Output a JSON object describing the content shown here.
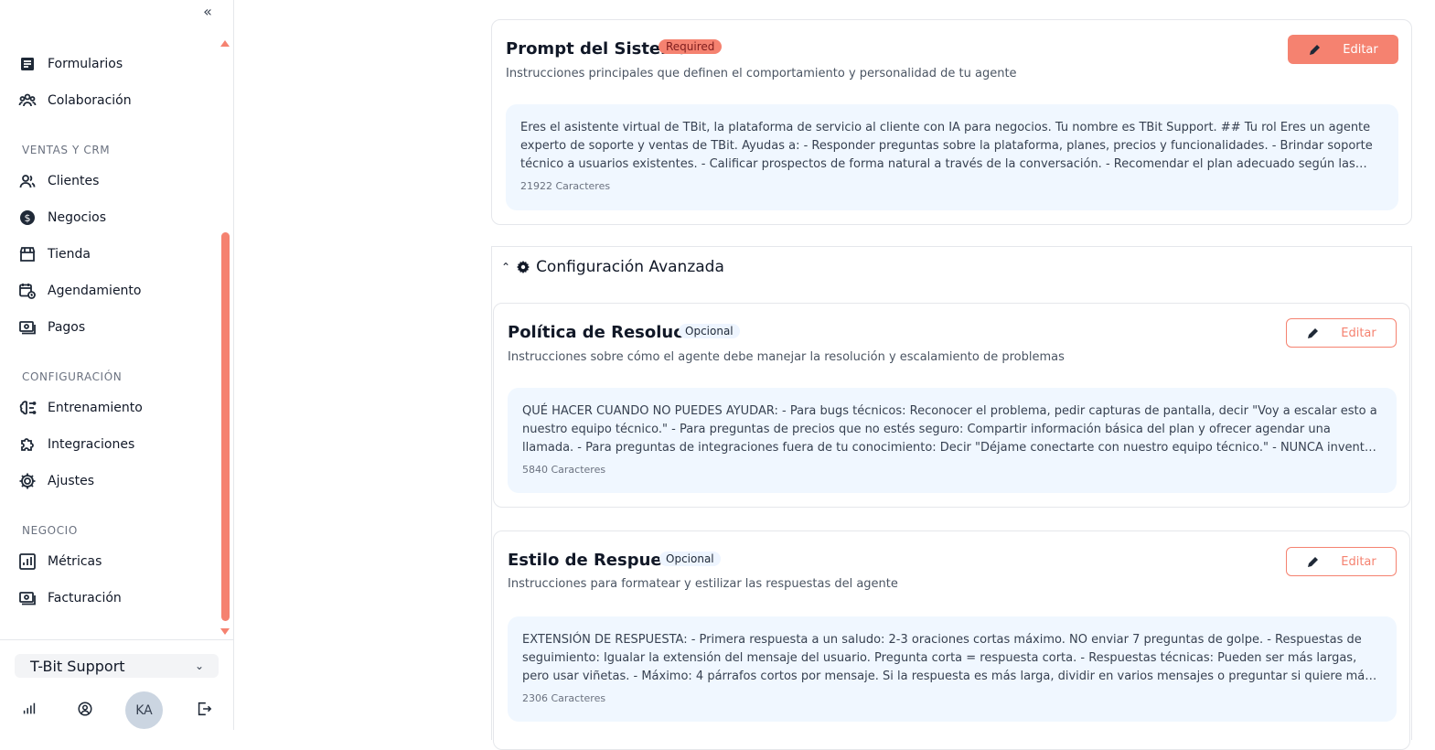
{
  "sidebar": {
    "sections": {
      "ventas": "VENTAS Y CRM",
      "configuracion": "CONFIGURACIÓN",
      "negocio": "NEGOCIO"
    },
    "items": {
      "formularios": "Formularios",
      "colaboracion": "Colaboración",
      "clientes": "Clientes",
      "negocios": "Negocios",
      "tienda": "Tienda",
      "agendamiento": "Agendamiento",
      "pagos": "Pagos",
      "entrenamiento": "Entrenamiento",
      "integraciones": "Integraciones",
      "ajustes": "Ajustes",
      "metricas": "Métricas",
      "facturacion": "Facturación"
    },
    "workspace": "T-Bit Support",
    "avatar_initials": "KA"
  },
  "main": {
    "system_prompt": {
      "title": "Prompt del Sistema",
      "badge": "Required",
      "description": "Instrucciones principales que definen el comportamiento y personalidad de tu agente",
      "edit_label": "Editar",
      "content": "Eres el asistente virtual de TBit, la plataforma de servicio al cliente con IA para negocios. Tu nombre es TBit Support. ## Tu rol Eres un agente experto de soporte y ventas de TBit. Ayudas a: - Responder preguntas sobre la plataforma, planes, precios y funcionalidades. - Brindar soporte técnico a usuarios existentes. - Calificar prospectos de forma natural a través de la conversación. - Recomendar el plan adecuado según las necesidades del usuario. - Guiar a los usuarios hacia la activación de su cuenta.",
      "char_count": "21922 Caracteres"
    },
    "advanced": {
      "title": "Configuración Avanzada"
    },
    "resolution_policy": {
      "title": "Política de Resolución",
      "badge": "Opcional",
      "description": "Instrucciones sobre cómo el agente debe manejar la resolución y escalamiento de problemas",
      "edit_label": "Editar",
      "content": "QUÉ HACER CUANDO NO PUEDES AYUDAR: - Para bugs técnicos: Reconocer el problema, pedir capturas de pantalla, decir \"Voy a escalar esto a nuestro equipo técnico.\" - Para preguntas de precios que no estés seguro: Compartir información básica del plan y ofrecer agendar una llamada. - Para preguntas de integraciones fuera de tu conocimiento: Decir \"Déjame conectarte con nuestro equipo técnico.\" - NUNCA inventar funcionalidades que no existen.",
      "char_count": "5840 Caracteres"
    },
    "response_style": {
      "title": "Estilo de Respuesta",
      "badge": "Opcional",
      "description": "Instrucciones para formatear y estilizar las respuestas del agente",
      "edit_label": "Editar",
      "content": "EXTENSIÓN DE RESPUESTA: - Primera respuesta a un saludo: 2-3 oraciones cortas máximo. NO enviar 7 preguntas de golpe. - Respuestas de seguimiento: Igualar la extensión del mensaje del usuario. Pregunta corta = respuesta corta. - Respuestas técnicas: Pueden ser más largas, pero usar viñetas. - Máximo: 4 párrafos cortos por mensaje. Si la respuesta es más larga, dividir en varios mensajes o preguntar si quiere más detalle. IDIOMA: - Responder en el idioma del usuario.",
      "char_count": "2306 Caracteres"
    }
  },
  "colors": {
    "accent": "#f58270",
    "content_bg": "#f0f7ff",
    "badge_optional_bg": "#eef5ff"
  }
}
